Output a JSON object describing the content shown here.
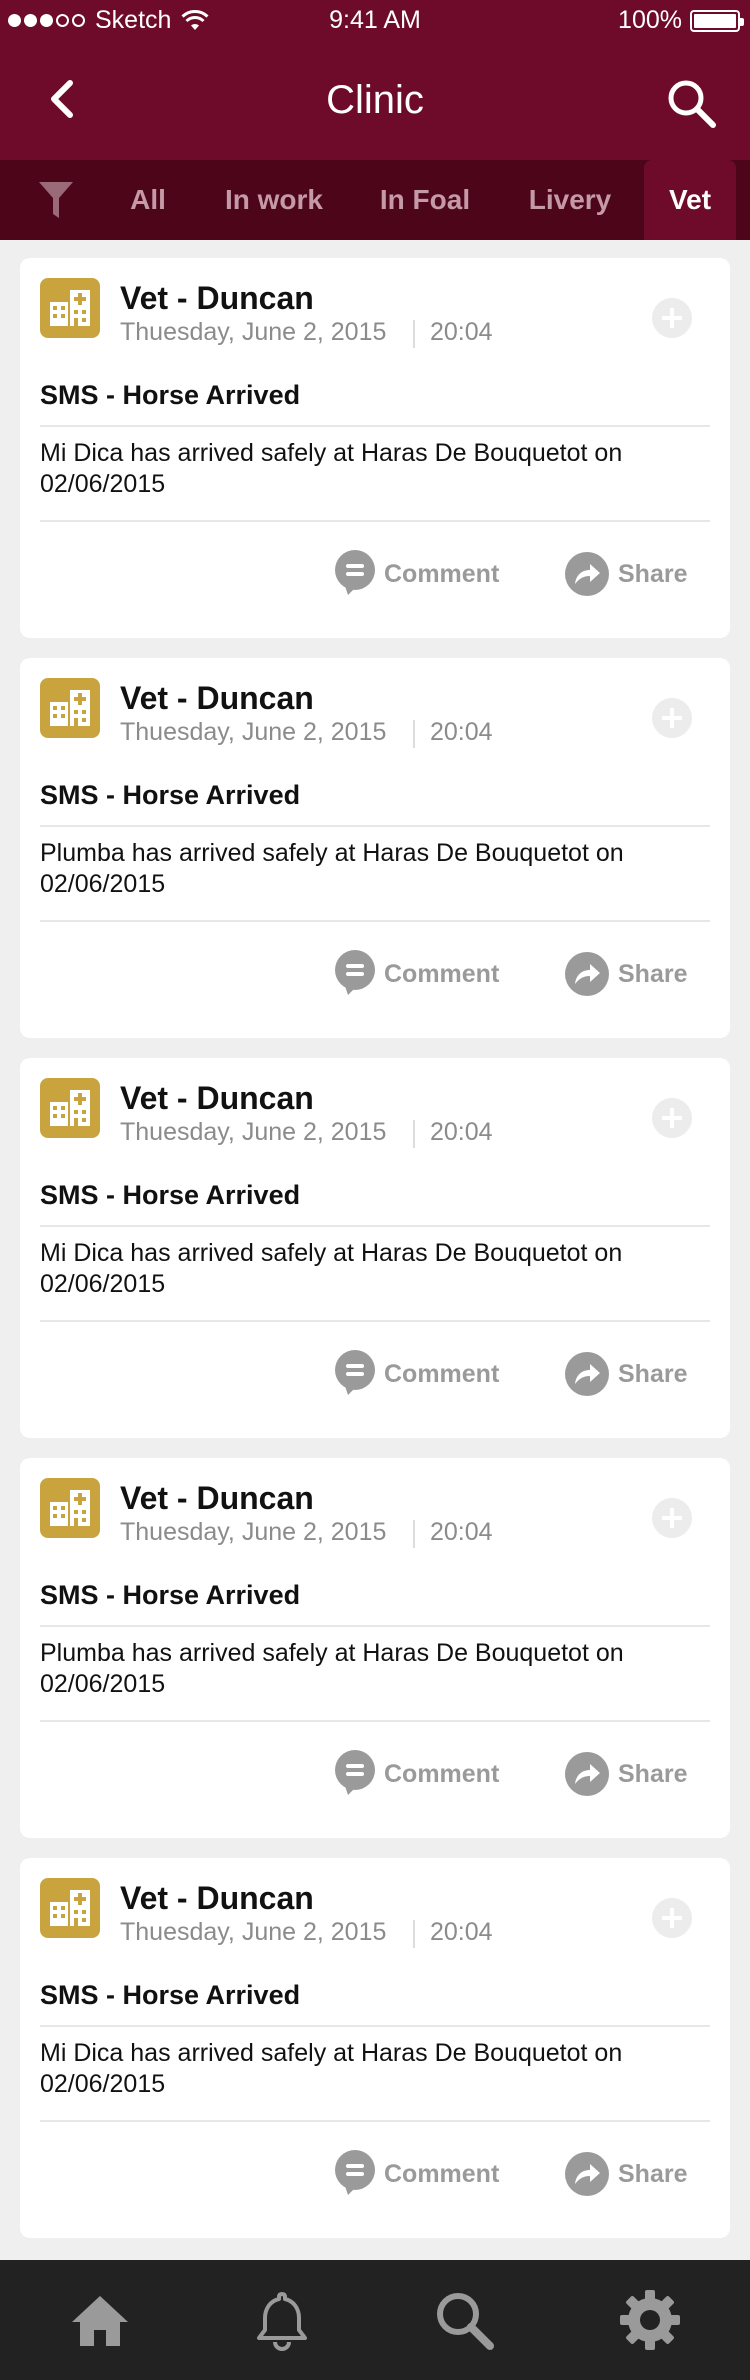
{
  "status_bar": {
    "carrier": "Sketch",
    "time": "9:41 AM",
    "battery": "100%",
    "battery_level": 1.0
  },
  "navbar": {
    "title": "Clinic",
    "back_icon": "chevron-left-icon",
    "search_icon": "search-icon"
  },
  "tabs": {
    "filter_icon": "filter-icon",
    "items": [
      {
        "label": "All",
        "active": false
      },
      {
        "label": "In work",
        "active": false
      },
      {
        "label": "In Foal",
        "active": false
      },
      {
        "label": "Livery",
        "active": false
      },
      {
        "label": "Vet",
        "active": true
      }
    ]
  },
  "colors": {
    "header": "#6e0b2a",
    "tab_bar": "#4d0619",
    "icon_gold": "#c9a43e",
    "bottom_bar": "#222222"
  },
  "cards": [
    {
      "title": "Vet - Duncan",
      "date": "Thuesday, June 2, 2015",
      "time": "20:04",
      "subject": "SMS - Horse Arrived",
      "body": "Mi Dica has arrived safely at Haras De Bouquetot on 02/06/2015",
      "comment_label": "Comment",
      "share_label": "Share"
    },
    {
      "title": "Vet - Duncan",
      "date": "Thuesday, June 2, 2015",
      "time": "20:04",
      "subject": "SMS - Horse Arrived",
      "body": "Plumba has arrived safely at Haras De Bouquetot on 02/06/2015",
      "comment_label": "Comment",
      "share_label": "Share"
    },
    {
      "title": "Vet - Duncan",
      "date": "Thuesday, June 2, 2015",
      "time": "20:04",
      "subject": "SMS - Horse Arrived",
      "body": "Mi Dica has arrived safely at Haras De Bouquetot on 02/06/2015",
      "comment_label": "Comment",
      "share_label": "Share"
    },
    {
      "title": "Vet - Duncan",
      "date": "Thuesday, June 2, 2015",
      "time": "20:04",
      "subject": "SMS - Horse Arrived",
      "body": "Plumba has arrived safely at Haras De Bouquetot on 02/06/2015",
      "comment_label": "Comment",
      "share_label": "Share"
    },
    {
      "title": "Vet - Duncan",
      "date": "Thuesday, June 2, 2015",
      "time": "20:04",
      "subject": "SMS - Horse Arrived",
      "body": "Mi Dica has arrived safely at Haras De Bouquetot on 02/06/2015",
      "comment_label": "Comment",
      "share_label": "Share"
    }
  ],
  "bottom_bar": {
    "items": [
      {
        "icon": "home-icon"
      },
      {
        "icon": "bell-icon"
      },
      {
        "icon": "search-icon"
      },
      {
        "icon": "gear-icon"
      }
    ]
  }
}
